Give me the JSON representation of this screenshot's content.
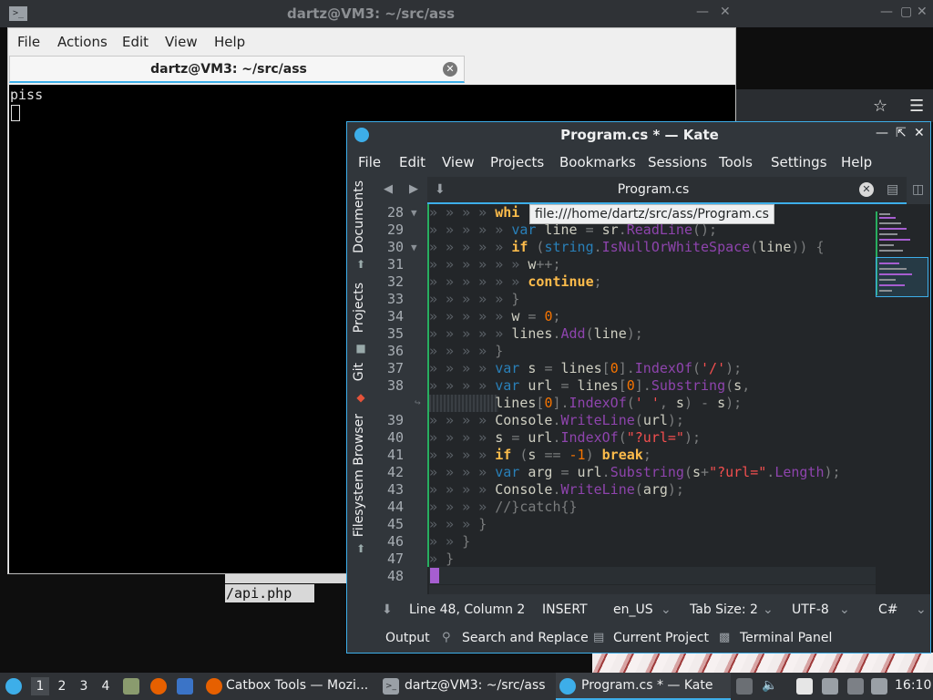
{
  "bg_terminal": {
    "title": "dartz@VM3: ~/src/ass",
    "menu": [
      "File",
      "Actions",
      "Edit",
      "View",
      "Help"
    ],
    "tab_label": "dartz@VM3: ~/src/ass",
    "output_line": "piss",
    "behind_text_line2": "/api.php"
  },
  "kate": {
    "title": "Program.cs * — Kate",
    "menu": [
      "File",
      "Edit",
      "View",
      "Projects",
      "Bookmarks",
      "Sessions",
      "Tools",
      "Settings",
      "Help"
    ],
    "sidebar": [
      "Documents",
      "Projects",
      "Git",
      "Filesystem Browser"
    ],
    "doc_tab": "Program.cs",
    "tooltip": "file:///home/dartz/src/ass/Program.cs",
    "line_numbers": [
      "28",
      "29",
      "30",
      "31",
      "32",
      "33",
      "34",
      "35",
      "36",
      "37",
      "38",
      "",
      "39",
      "40",
      "41",
      "42",
      "43",
      "44",
      "45",
      "46",
      "47",
      "48"
    ],
    "status": {
      "position": "Line 48, Column 2",
      "mode": "INSERT",
      "dictionary": "en_US",
      "tab_size": "Tab Size: 2",
      "encoding": "UTF-8",
      "syntax": "C#"
    },
    "panels": [
      "Output",
      "Search and Replace",
      "Current Project",
      "Terminal Panel"
    ]
  },
  "taskbar": {
    "desktops": [
      "1",
      "2",
      "3",
      "4"
    ],
    "tasks": [
      "Catbox Tools — Mozi...",
      "dartz@VM3: ~/src/ass",
      "Program.cs * — Kate"
    ],
    "clock": "16:10"
  },
  "colors": {
    "accent": "#3daee9",
    "editor_bg": "#232629",
    "window_bg": "#31363b"
  }
}
